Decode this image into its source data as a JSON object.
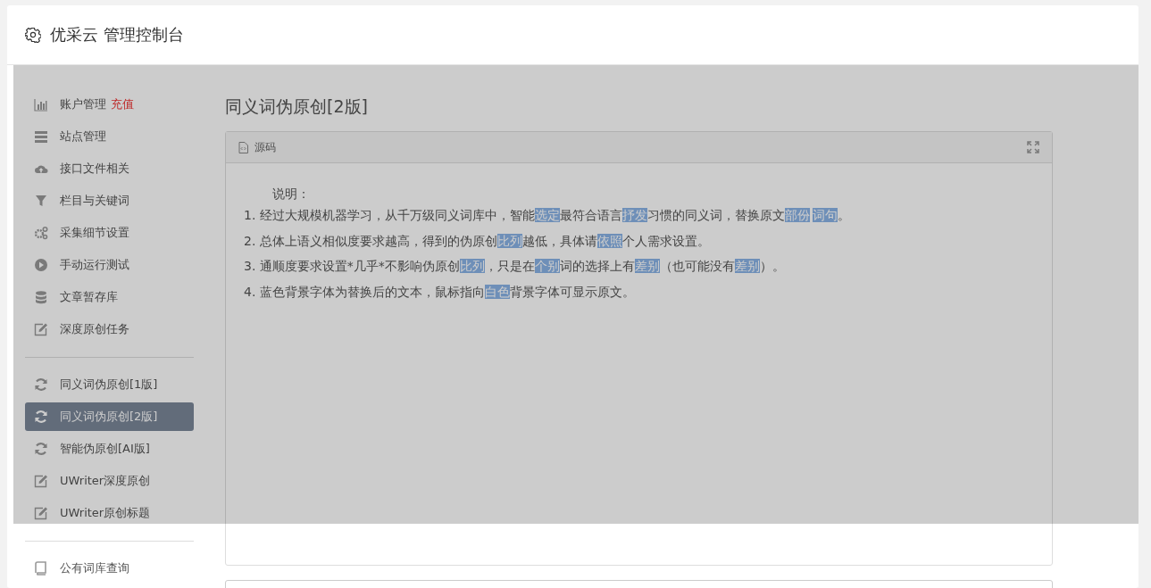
{
  "header": {
    "title": "优采云 管理控制台"
  },
  "sidebar": {
    "groups": [
      {
        "items": [
          {
            "label": "账户管理",
            "badge": "充值",
            "selected": false
          },
          {
            "label": "站点管理",
            "selected": false
          },
          {
            "label": "接口文件相关",
            "selected": false
          },
          {
            "label": "栏目与关键词",
            "selected": false
          },
          {
            "label": "采集细节设置",
            "selected": false
          },
          {
            "label": "手动运行测试",
            "selected": false
          },
          {
            "label": "文章暂存库",
            "selected": false
          },
          {
            "label": "深度原创任务",
            "selected": false
          }
        ]
      },
      {
        "items": [
          {
            "label": "同义词伪原创[1版]",
            "selected": false
          },
          {
            "label": "同义词伪原创[2版]",
            "selected": true
          },
          {
            "label": "智能伪原创[AI版]",
            "selected": false
          },
          {
            "label": "UWriter深度原创",
            "selected": false
          },
          {
            "label": "UWriter原创标题",
            "selected": false
          }
        ]
      },
      {
        "items": [
          {
            "label": "公有词库查询",
            "selected": false
          }
        ]
      }
    ]
  },
  "page_title": "同义词伪原创[2版]",
  "panel": {
    "tab": "源码",
    "intro": "说明：",
    "lines": [
      [
        {
          "text": "1. 经过大规模机器学习，从千万级同义词库中，智能",
          "replaced": false
        },
        {
          "text": "选定",
          "replaced": true
        },
        {
          "text": "最符合语言",
          "replaced": false
        },
        {
          "text": "抒发",
          "replaced": true
        },
        {
          "text": "习惯的同义词，替换原文",
          "replaced": false
        },
        {
          "text": "部份",
          "replaced": true
        },
        {
          "text": "词句",
          "replaced": true
        },
        {
          "text": "。",
          "replaced": false
        }
      ],
      [
        {
          "text": "2. 总体上语义相似度要求越高，得到的伪原创",
          "replaced": false
        },
        {
          "text": "比列",
          "replaced": true
        },
        {
          "text": "越低，具体请",
          "replaced": false
        },
        {
          "text": "依照",
          "replaced": true
        },
        {
          "text": "个人需求设置。",
          "replaced": false
        }
      ],
      [
        {
          "text": "3. 通顺度要求设置*几乎*不影响伪原创",
          "replaced": false
        },
        {
          "text": "比列",
          "replaced": true
        },
        {
          "text": "，只是在",
          "replaced": false
        },
        {
          "text": "个别",
          "replaced": true
        },
        {
          "text": "词的选择上有",
          "replaced": false
        },
        {
          "text": "差别",
          "replaced": true
        },
        {
          "text": "（也可能没有",
          "replaced": false
        },
        {
          "text": "差别",
          "replaced": true
        },
        {
          "text": "）。",
          "replaced": false
        }
      ],
      [
        {
          "text": "4. 蓝色背景字体为替换后的文本，鼠标指向",
          "replaced": false
        },
        {
          "text": "白色",
          "replaced": true
        },
        {
          "text": "背景字体可显示原文。",
          "replaced": false
        }
      ]
    ]
  },
  "loading": true
}
